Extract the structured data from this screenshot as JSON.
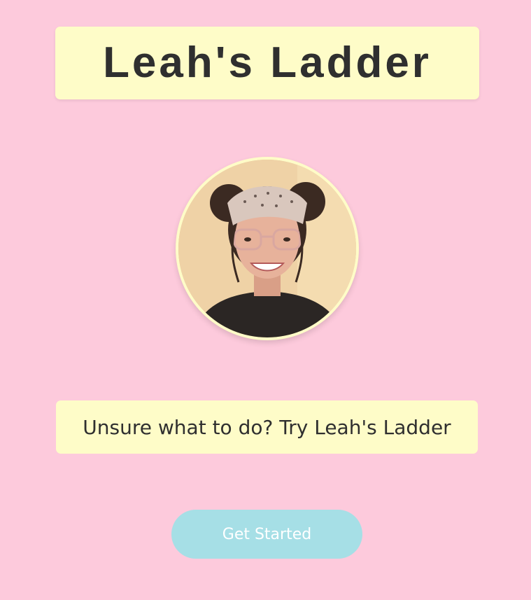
{
  "header": {
    "title": "Leah's Ladder"
  },
  "profile": {
    "avatar_icon": "person-photo"
  },
  "tagline": {
    "text": "Unsure what to do? Try Leah's Ladder"
  },
  "actions": {
    "get_started_label": "Get Started"
  },
  "colors": {
    "background": "#fdcadc",
    "card": "#fefcc8",
    "button": "#a6dfe6",
    "text": "#2f2f2f"
  }
}
